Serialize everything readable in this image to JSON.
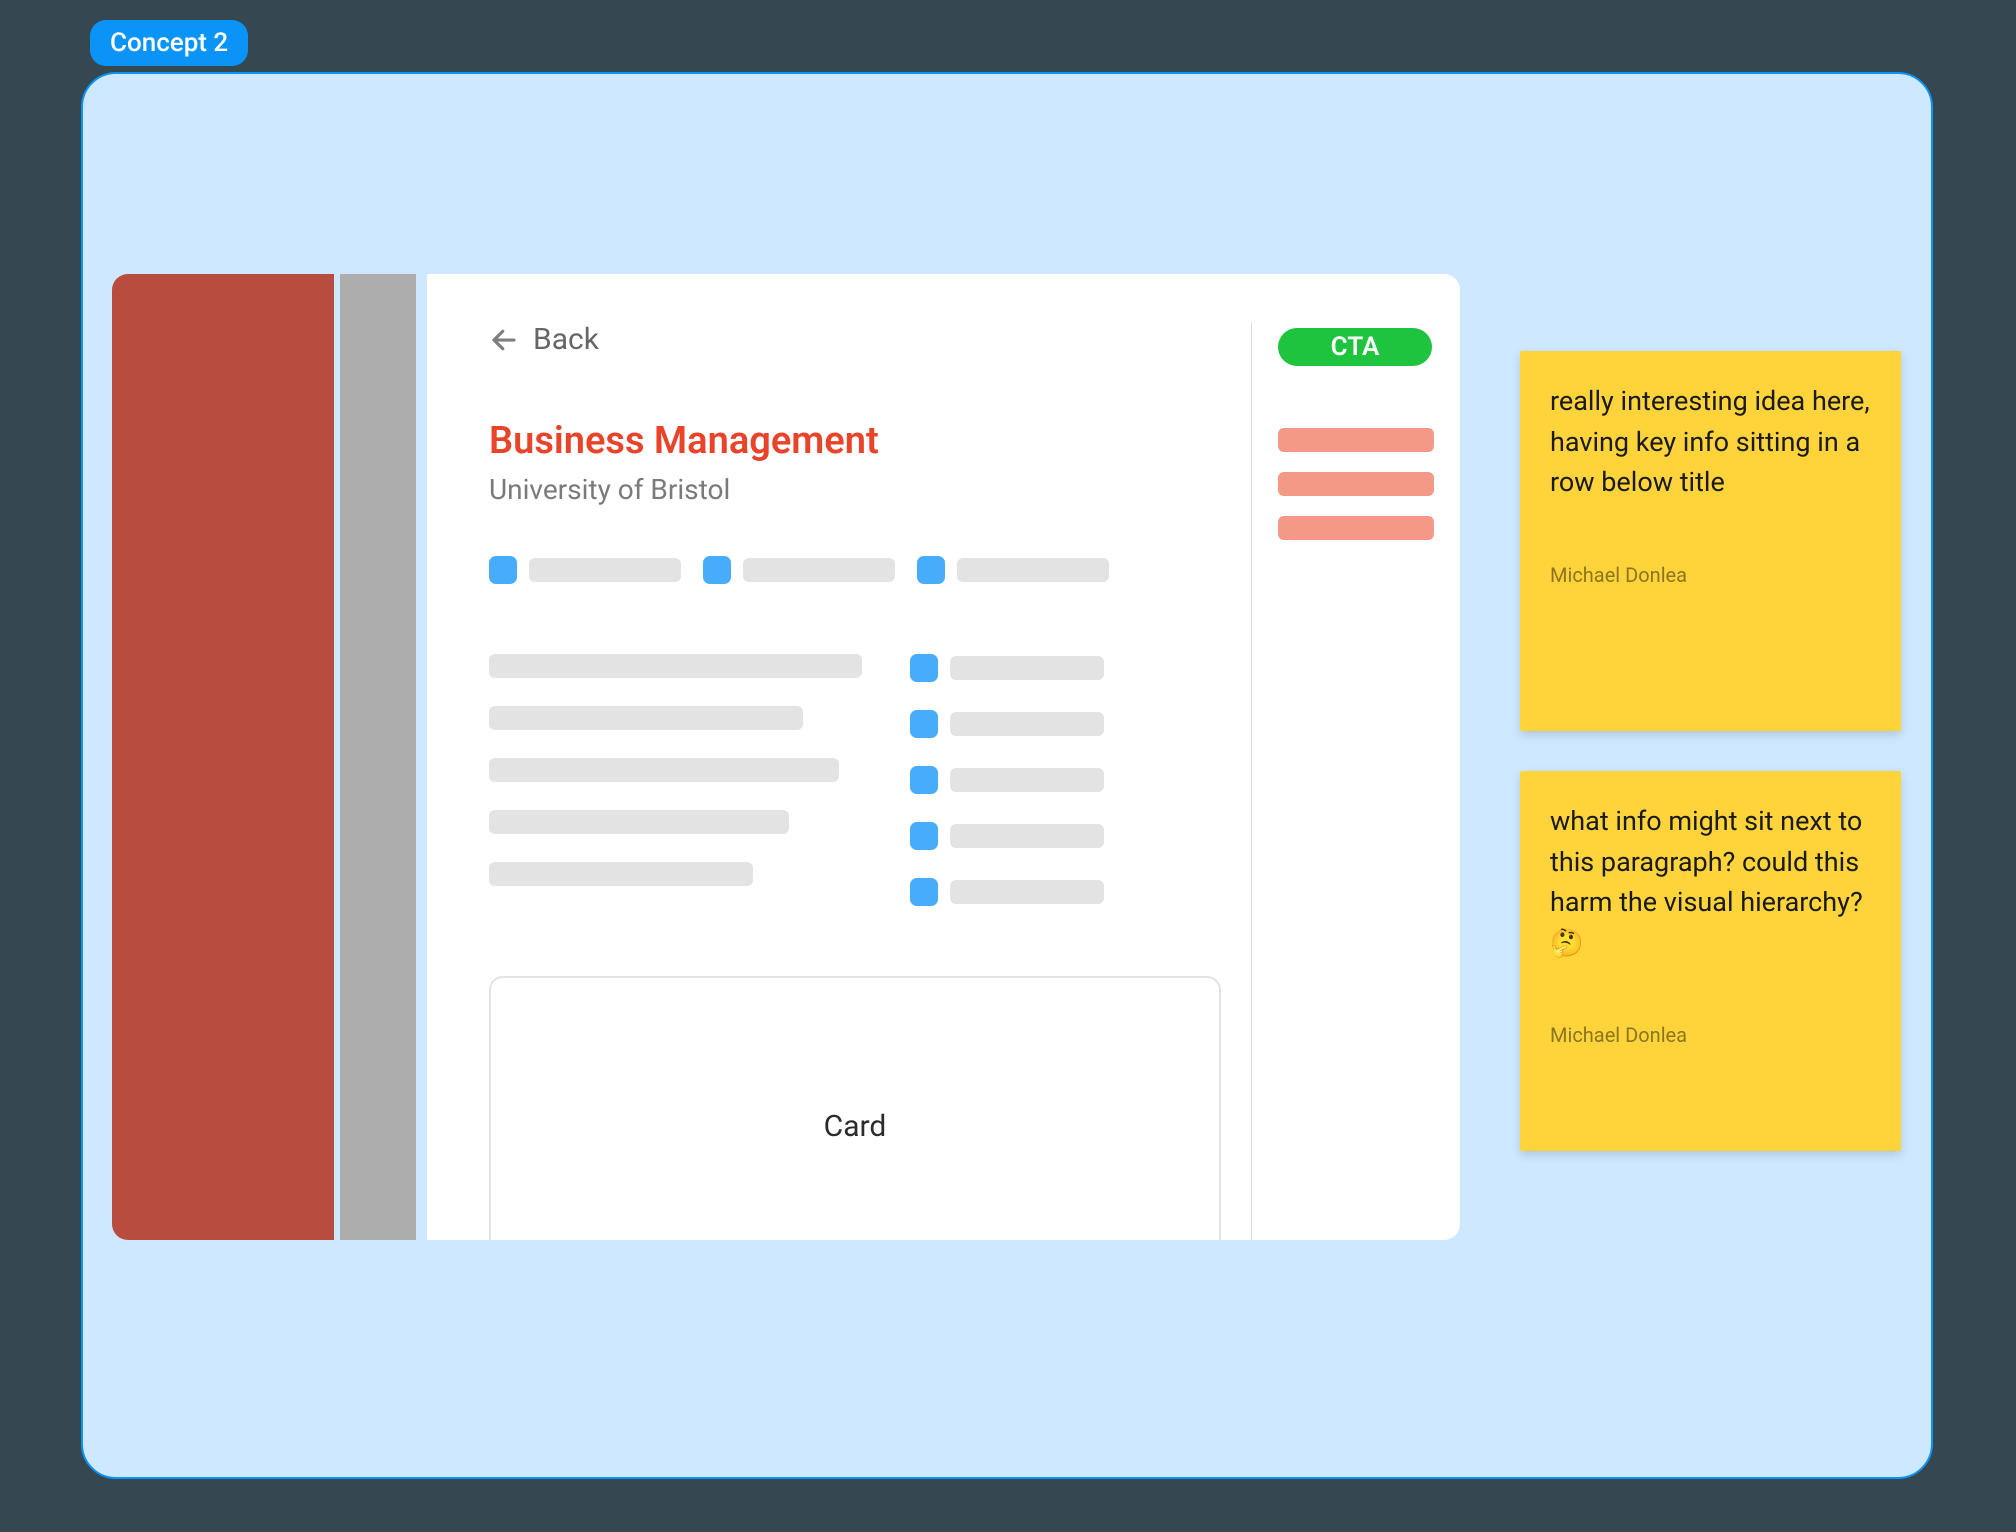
{
  "badge": {
    "label": "Concept 2"
  },
  "back": {
    "label": "Back"
  },
  "page": {
    "title": "Business Management",
    "subtitle": "University of Bristol"
  },
  "card": {
    "label": "Card"
  },
  "cta": {
    "label": "CTA"
  },
  "stickies": [
    {
      "text": "really interesting idea here, having key info sitting in a row below title",
      "author": "Michael Donlea"
    },
    {
      "text": "what info might sit next to this paragraph? could this harm the visual hierarchy? 🤔",
      "author": "Michael Donlea"
    }
  ]
}
